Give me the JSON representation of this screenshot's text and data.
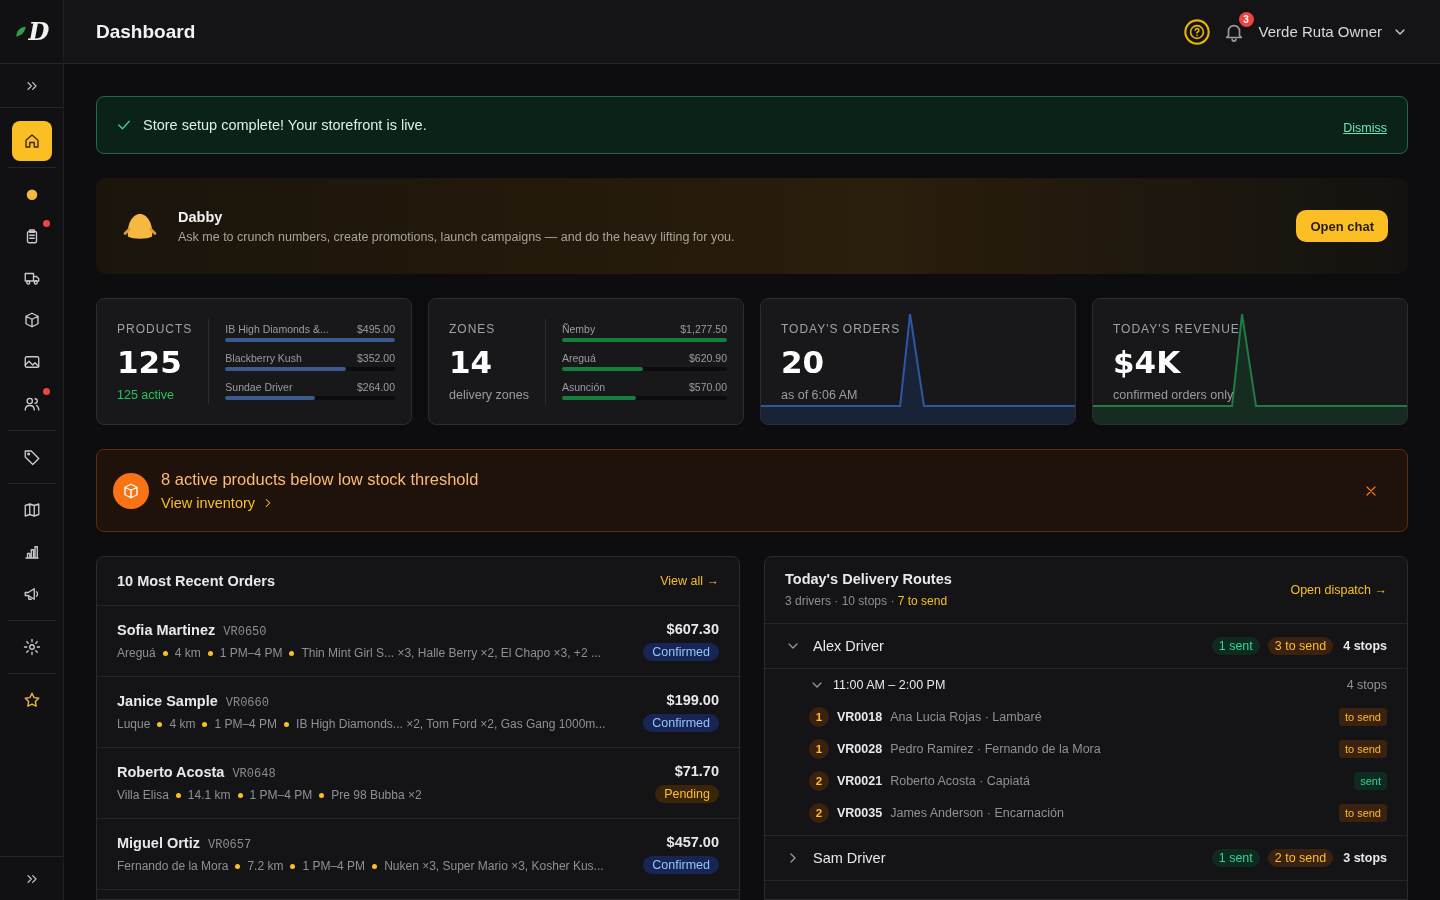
{
  "logo": {
    "letter": "D"
  },
  "sidebar": {
    "items": [
      {
        "selected": true,
        "dot": false
      },
      {
        "selected": false,
        "dot": false
      },
      {
        "selected": false,
        "dot": true
      },
      {
        "selected": false,
        "dot": false
      },
      {
        "selected": false,
        "dot": false
      },
      {
        "selected": false,
        "dot": false
      },
      {
        "selected": false,
        "dot": true
      },
      {
        "selected": false,
        "dot": false
      },
      {
        "selected": false,
        "dot": false
      },
      {
        "selected": false,
        "dot": false
      },
      {
        "selected": false,
        "dot": false
      },
      {
        "selected": false,
        "dot": false
      },
      {
        "selected": false,
        "dot": false
      }
    ]
  },
  "header": {
    "title": "Dashboard",
    "notifications": "3",
    "user": "Verde Ruta Owner"
  },
  "setup_banner": {
    "message": "Store setup complete! Your storefront is live.",
    "action": "Dismiss"
  },
  "assistant": {
    "name": "Dabby",
    "text": "Ask me to crunch numbers, create promotions, launch campaigns — and do the heavy lifting for you.",
    "button": "Open chat"
  },
  "stats": [
    {
      "kind": "bars",
      "label": "PRODUCTS",
      "value": "125",
      "caption": "125 active",
      "rows": [
        {
          "name": "IB High Diamonds &...",
          "amount": "$495.00",
          "level": 1
        },
        {
          "name": "Blackberry Kush",
          "amount": "$352.00",
          "level": 0.71
        },
        {
          "name": "Sundae Driver",
          "amount": "$264.00",
          "level": 0.53
        }
      ]
    },
    {
      "kind": "bars",
      "label": "ZONES",
      "value": "14",
      "caption": "delivery zones",
      "rows": [
        {
          "name": "Ñemby",
          "amount": "$1,277.50",
          "level": 1
        },
        {
          "name": "Areguá",
          "amount": "$620.90",
          "level": 0.49
        },
        {
          "name": "Asunción",
          "amount": "$570.00",
          "level": 0.45
        }
      ]
    },
    {
      "kind": "spark",
      "label": "TODAY'S ORDERS",
      "value": "20",
      "caption": "as of 6:06 AM"
    },
    {
      "kind": "spark",
      "label": "TODAY'S REVENUE",
      "value": "$4K",
      "caption": "confirmed orders only"
    }
  ],
  "stock_alert": {
    "message": "8 active products below low stock threshold",
    "link": "View inventory"
  },
  "orders": {
    "title": "10 Most Recent Orders",
    "action": "View all →",
    "rows": [
      {
        "name": "Sofia Martinez",
        "code": "VR0650",
        "meta": [
          "Areguá",
          "4 km",
          "1 PM–4 PM",
          "Thin Mint Girl S... ×3, Halle Berry ×2, El Chapo ×3, +2 ..."
        ],
        "amount": "$607.30",
        "status": "Confirmed",
        "kind": "confirmed"
      },
      {
        "name": "Janice Sample",
        "code": "VR0660",
        "meta": [
          "Luque",
          "4 km",
          "1 PM–4 PM",
          "IB High Diamonds... ×2, Tom Ford ×2, Gas Gang 1000m..."
        ],
        "amount": "$199.00",
        "status": "Confirmed",
        "kind": "confirmed"
      },
      {
        "name": "Roberto Acosta",
        "code": "VR0648",
        "meta": [
          "Villa Elisa",
          "14.1 km",
          "1 PM–4 PM",
          "Pre 98 Bubba ×2"
        ],
        "amount": "$71.70",
        "status": "Pending",
        "kind": "pending"
      },
      {
        "name": "Miguel Ortiz",
        "code": "VR0657",
        "meta": [
          "Fernando de la Mora",
          "7.2 km",
          "1 PM–4 PM",
          "Nuken ×3, Super Mario ×3, Kosher Kus..."
        ],
        "amount": "$457.00",
        "status": "Confirmed",
        "kind": "confirmed"
      }
    ]
  },
  "routes": {
    "title": "Today's Delivery Routes",
    "summary": "3 drivers · 10 stops · ",
    "to_send": "7 to send",
    "action": "Open dispatch →",
    "drivers": [
      {
        "name": "Alex Driver",
        "expanded": true,
        "sent": "1 sent",
        "to_send": "3 to send",
        "stops": "4 stops",
        "slots": [
          {
            "time": "11:00 AM – 2:00 PM",
            "stops": "4 stops",
            "expanded": true,
            "items": [
              {
                "number": "1",
                "code": "VR0018",
                "detail": "Ana Lucia Rojas · Lambaré",
                "status": "to send",
                "kind": "to_send"
              },
              {
                "number": "1",
                "code": "VR0028",
                "detail": "Pedro Ramirez · Fernando de la Mora",
                "status": "to send",
                "kind": "to_send"
              },
              {
                "number": "2",
                "code": "VR0021",
                "detail": "Roberto Acosta · Capiatá",
                "status": "sent",
                "kind": "sent"
              },
              {
                "number": "2",
                "code": "VR0035",
                "detail": "James Anderson · Encarnación",
                "status": "to send",
                "kind": "to_send"
              }
            ]
          }
        ]
      },
      {
        "name": "Sam Driver",
        "expanded": false,
        "sent": "1 sent",
        "to_send": "2 to send",
        "stops": "3 stops"
      }
    ]
  }
}
